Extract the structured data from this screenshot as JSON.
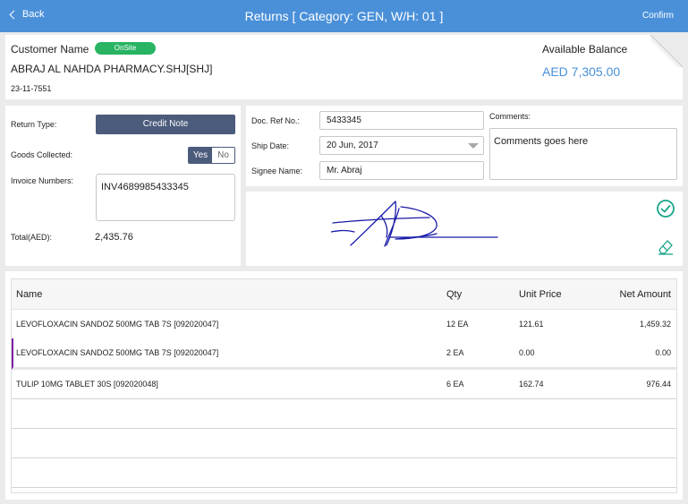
{
  "nav": {
    "back_label": "Back",
    "title": "Returns [ Category: GEN, W/H: 01 ]",
    "confirm_label": "Confirm"
  },
  "customer": {
    "label": "Customer Name",
    "status_badge": "OnSite",
    "name": "ABRAJ AL NAHDA PHARMACY.SHJ[SHJ]",
    "code": "23-11-7551",
    "balance_label": "Available Balance",
    "balance_value": "AED 7,305.00"
  },
  "details": {
    "return_type_label": "Return Type:",
    "return_type_value": "Credit Note",
    "goods_collected_label": "Goods Collected:",
    "yes_label": "Yes",
    "no_label": "No",
    "goods_collected_value": "Yes",
    "invoice_label": "Invoice Numbers:",
    "invoice_value": "INV4689985433345",
    "total_label": "Total(AED):",
    "total_value": "2,435.76"
  },
  "form": {
    "doc_ref_label": "Doc. Ref No.:",
    "doc_ref_value": "5433345",
    "ship_date_label": "Ship Date:",
    "ship_date_value": "20 Jun, 2017",
    "signee_label": "Signee Name:",
    "signee_value": "Mr. Abraj",
    "comments_label": "Comments:",
    "comments_value": "Comments goes here"
  },
  "icons": {
    "confirm_signature": "check-circle-icon",
    "clear_signature": "eraser-icon"
  },
  "colors": {
    "nav_bar": "#4a90d9",
    "badge_green": "#28b463",
    "button_slate": "#4b5b7c",
    "accent_blue": "#4a90d9",
    "signature_ink": "#1a1aa8",
    "selected_row_marker": "#7d1fa3",
    "icon_teal": "#17a589"
  },
  "table": {
    "headers": {
      "name": "Name",
      "qty": "Qty",
      "unit_price": "Unit Price",
      "net_amount": "Net Amount"
    },
    "rows": [
      {
        "name": "LEVOFLOXACIN SANDOZ 500MG TAB 7S [092020047]",
        "qty": "12 EA",
        "unit_price": "121.61",
        "net_amount": "1,459.32"
      },
      {
        "name": "LEVOFLOXACIN SANDOZ 500MG TAB 7S [092020047]",
        "qty": "2 EA",
        "unit_price": "0.00",
        "net_amount": "0.00"
      },
      {
        "name": "TULIP 10MG TABLET 30S [092020048]",
        "qty": "6 EA",
        "unit_price": "162.74",
        "net_amount": "976.44"
      }
    ]
  }
}
